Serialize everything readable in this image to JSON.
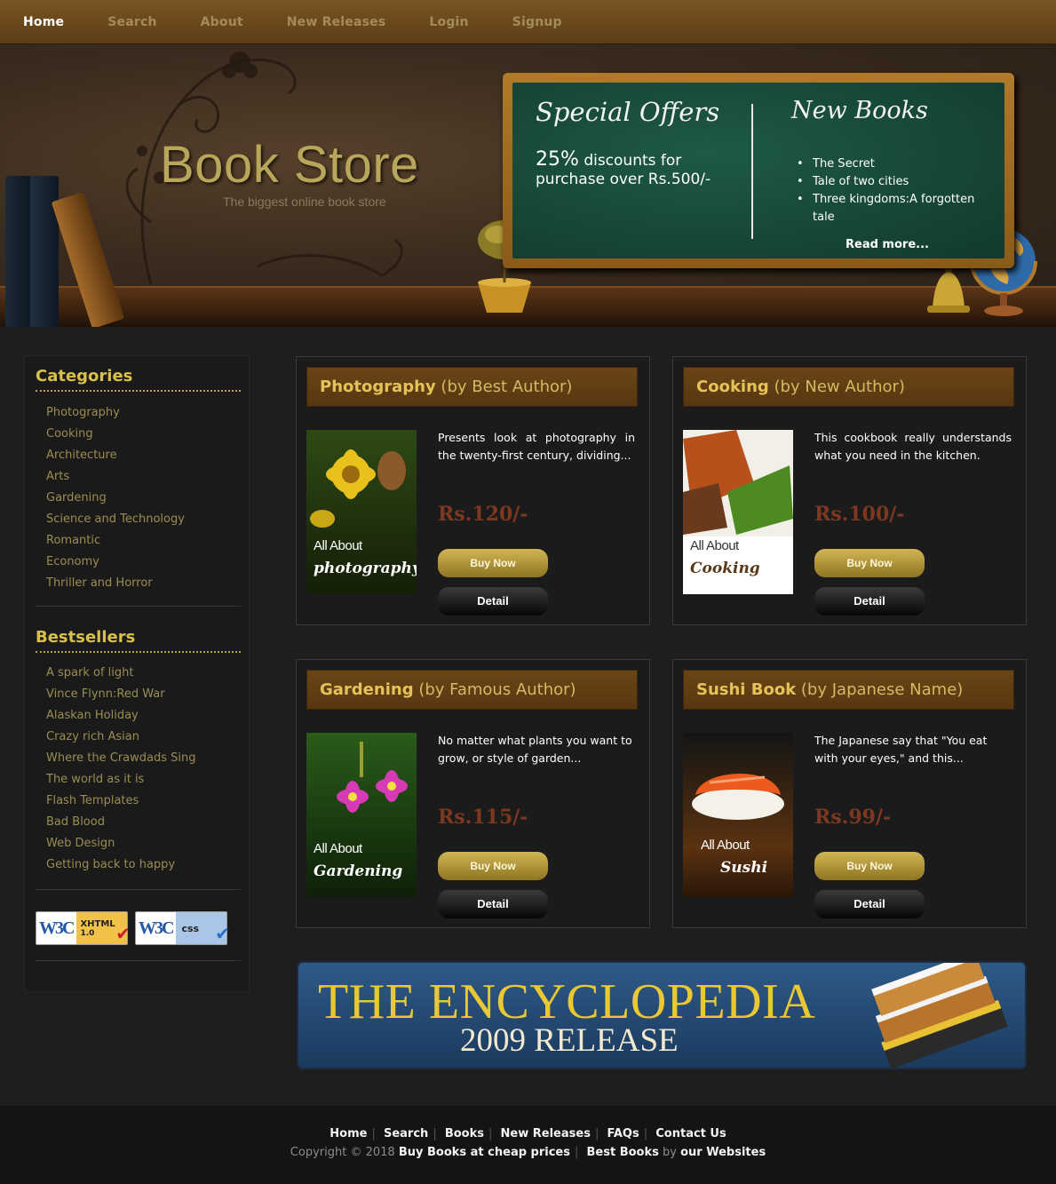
{
  "nav": {
    "items": [
      {
        "label": "Home"
      },
      {
        "label": "Search"
      },
      {
        "label": "About"
      },
      {
        "label": "New Releases"
      },
      {
        "label": "Login"
      },
      {
        "label": "Signup"
      }
    ]
  },
  "header": {
    "title": "Book Store",
    "subtitle": "The biggest online book store",
    "special_offers": {
      "title": "Special Offers",
      "percent": "25%",
      "text": "discounts for purchase over Rs.500/-"
    },
    "new_books": {
      "title": "New Books",
      "items": [
        "The Secret",
        "Tale of two cities",
        "Three kingdoms:A forgotten tale"
      ],
      "read_more": "Read more..."
    }
  },
  "sidebar": {
    "categories_title": "Categories",
    "categories": [
      "Photography",
      "Cooking",
      "Architecture",
      "Arts",
      "Gardening",
      "Science and Technology",
      "Romantic",
      "Economy",
      "Thriller and Horror"
    ],
    "bestsellers_title": "Bestsellers",
    "bestsellers": [
      "A spark of light",
      "Vince Flynn:Red War",
      "Alaskan Holiday",
      "Crazy rich Asian",
      "Where the Crawdads Sing",
      "The world as it is",
      "Flash Templates",
      "Bad Blood",
      "Web Design",
      "Getting back to happy"
    ],
    "badges": [
      {
        "logo": "W3C",
        "label": "XHTML",
        "version": "1.0"
      },
      {
        "logo": "W3C",
        "label": "css"
      }
    ]
  },
  "products": [
    {
      "name": "Photography",
      "by": "(by Best Author)",
      "desc": "Presents look at photography in the twenty-first century, dividing...",
      "price": "Rs.120/-",
      "cover_all": "All About",
      "cover_name": "photography",
      "buy_label": "Buy Now",
      "detail_label": "Detail"
    },
    {
      "name": "Cooking",
      "by": "(by New Author)",
      "desc": "This cookbook really understands what you need in the kitchen.",
      "price": "Rs.100/-",
      "cover_all": "All About",
      "cover_name": "Cooking",
      "buy_label": "Buy Now",
      "detail_label": "Detail"
    },
    {
      "name": "Gardening",
      "by": "(by Famous Author)",
      "desc": "No matter what plants you want to grow, or style of garden...",
      "price": "Rs.115/-",
      "cover_all": "All About",
      "cover_name": "Gardening",
      "buy_label": "Buy Now",
      "detail_label": "Detail"
    },
    {
      "name": "Sushi Book",
      "by": "(by Japanese Name)",
      "desc": "The Japanese say that \"You eat with your eyes,\" and this...",
      "price": "Rs.99/-",
      "cover_all": "All About",
      "cover_name": "Sushi",
      "buy_label": "Buy Now",
      "detail_label": "Detail"
    }
  ],
  "banner": {
    "line1": "THE ENCYCLOPEDIA",
    "line2": "2009 RELEASE"
  },
  "footer": {
    "links": [
      "Home",
      "Search",
      "Books",
      "New Releases",
      "FAQs",
      "Contact Us"
    ],
    "copyright_prefix": "Copyright © 2018",
    "copyright_bold": "Buy Books at cheap prices",
    "best_books": "Best Books",
    "by": "by",
    "our_websites": "our Websites"
  }
}
